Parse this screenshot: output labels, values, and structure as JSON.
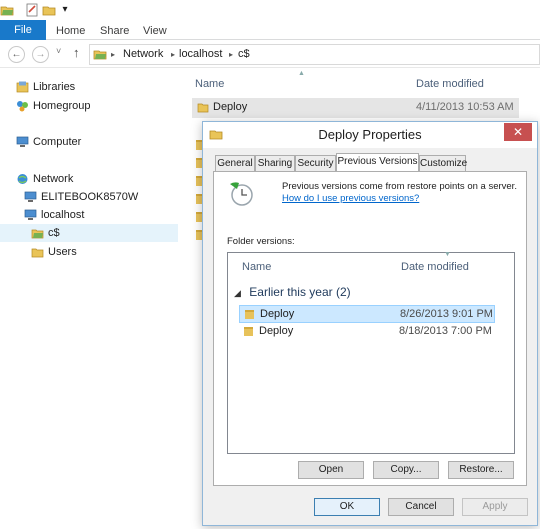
{
  "qat": {
    "dropdown_glyph": "▾"
  },
  "ribbon": {
    "tabs": [
      "File",
      "Home",
      "Share",
      "View"
    ]
  },
  "nav": {
    "back": "←",
    "forward": "→",
    "recent": "˅",
    "up": "↑"
  },
  "address": {
    "crumbs": [
      "Network",
      "localhost",
      "c$"
    ],
    "separator": "▸"
  },
  "sidebar": {
    "items": [
      {
        "label": "Libraries",
        "icon": "libraries-icon"
      },
      {
        "label": "Homegroup",
        "icon": "homegroup-icon"
      },
      {
        "label": "Computer",
        "icon": "computer-icon"
      },
      {
        "label": "Network",
        "icon": "network-icon"
      },
      {
        "label": "ELITEBOOK8570W",
        "icon": "computer-icon"
      },
      {
        "label": "localhost",
        "icon": "computer-icon"
      },
      {
        "label": "c$",
        "icon": "share-folder-icon"
      },
      {
        "label": "Users",
        "icon": "folder-icon"
      }
    ]
  },
  "filelist": {
    "headers": {
      "name": "Name",
      "date": "Date modified"
    },
    "rows": [
      {
        "name": "Deploy",
        "date": "4/11/2013 10:53 AM"
      }
    ]
  },
  "dialog": {
    "title": "Deploy Properties",
    "close_glyph": "✕",
    "tabs": [
      "General",
      "Sharing",
      "Security",
      "Previous Versions",
      "Customize"
    ],
    "active_tab": "Previous Versions",
    "description": "Previous versions come from restore points on a server.",
    "help_link": "How do I use previous versions?",
    "folder_versions_label": "Folder versions:",
    "list": {
      "headers": {
        "name": "Name",
        "date": "Date modified"
      },
      "group": "Earlier this year (2)",
      "group_toggle": "◢",
      "rows": [
        {
          "name": "Deploy",
          "date": "8/26/2013 9:01 PM",
          "selected": true
        },
        {
          "name": "Deploy",
          "date": "8/18/2013 7:00 PM",
          "selected": false
        }
      ]
    },
    "buttons": {
      "open": "Open",
      "copy": "Copy...",
      "restore": "Restore...",
      "ok": "OK",
      "cancel": "Cancel",
      "apply": "Apply"
    }
  },
  "colors": {
    "accent": "#1979ca",
    "selection": "#cce8ff",
    "close": "#c75050",
    "link": "#0066cc"
  }
}
